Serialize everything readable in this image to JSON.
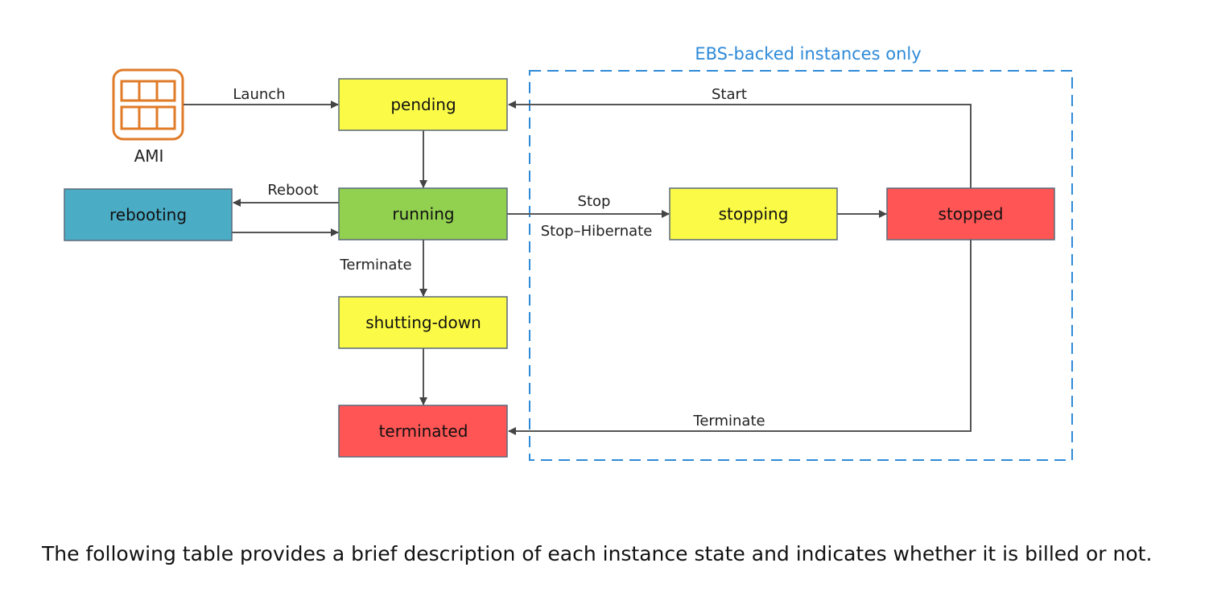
{
  "diagram": {
    "region_label": "EBS-backed instances only",
    "ami": {
      "label": "AMI",
      "icon": "ami-grid-icon",
      "color": "#e07b28"
    },
    "nodes": {
      "pending": {
        "label": "pending",
        "color": "#fbfb47"
      },
      "running": {
        "label": "running",
        "color": "#92d050"
      },
      "rebooting": {
        "label": "rebooting",
        "color": "#4bacc6"
      },
      "shutting_down": {
        "label": "shutting-down",
        "color": "#fbfb47"
      },
      "terminated": {
        "label": "terminated",
        "color": "#ff5555"
      },
      "stopping": {
        "label": "stopping",
        "color": "#fbfb47"
      },
      "stopped": {
        "label": "stopped",
        "color": "#ff5555"
      }
    },
    "edges": {
      "launch": "Launch",
      "start": "Start",
      "reboot": "Reboot",
      "stop": "Stop",
      "stop_hibernate": "Stop–Hibernate",
      "terminate_running": "Terminate",
      "terminate_stopped": "Terminate"
    },
    "region_color": "#2e8ad8"
  },
  "caption": "The following table provides a brief description of each instance state and indicates whether it is billed or not."
}
